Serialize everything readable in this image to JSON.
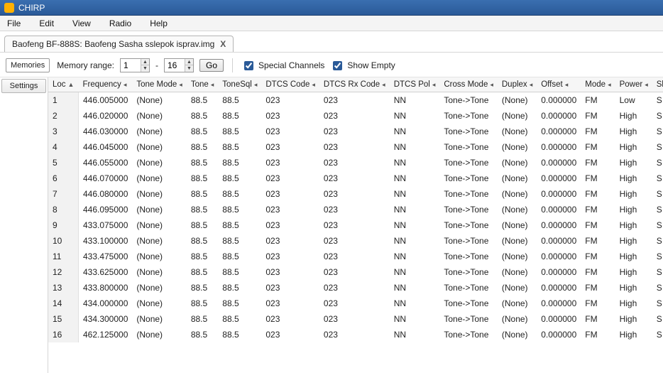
{
  "title": "CHIRP",
  "menu": [
    "File",
    "Edit",
    "View",
    "Radio",
    "Help"
  ],
  "tab": {
    "label": "Baofeng BF-888S: Baofeng Sasha sslepok isprav.img",
    "close": "X"
  },
  "side": {
    "memories": "Memories",
    "settings": "Settings"
  },
  "toolbar": {
    "range_label": "Memory range:",
    "range_from": "1",
    "range_sep": "-",
    "range_to": "16",
    "go": "Go",
    "special": "Special Channels",
    "show_empty": "Show Empty"
  },
  "columns": [
    "Loc",
    "Frequency",
    "Tone Mode",
    "Tone",
    "ToneSql",
    "DTCS Code",
    "DTCS Rx Code",
    "DTCS Pol",
    "Cross Mode",
    "Duplex",
    "Offset",
    "Mode",
    "Power",
    "Skip"
  ],
  "rows": [
    {
      "loc": "1",
      "freq": "446.005000",
      "tm": "(None)",
      "tone": "88.5",
      "tsql": "88.5",
      "dtcs": "023",
      "dtcsrx": "023",
      "pol": "NN",
      "cross": "Tone->Tone",
      "dup": "(None)",
      "off": "0.000000",
      "mode": "FM",
      "pow": "Low",
      "skip": "S"
    },
    {
      "loc": "2",
      "freq": "446.020000",
      "tm": "(None)",
      "tone": "88.5",
      "tsql": "88.5",
      "dtcs": "023",
      "dtcsrx": "023",
      "pol": "NN",
      "cross": "Tone->Tone",
      "dup": "(None)",
      "off": "0.000000",
      "mode": "FM",
      "pow": "High",
      "skip": "S"
    },
    {
      "loc": "3",
      "freq": "446.030000",
      "tm": "(None)",
      "tone": "88.5",
      "tsql": "88.5",
      "dtcs": "023",
      "dtcsrx": "023",
      "pol": "NN",
      "cross": "Tone->Tone",
      "dup": "(None)",
      "off": "0.000000",
      "mode": "FM",
      "pow": "High",
      "skip": "S"
    },
    {
      "loc": "4",
      "freq": "446.045000",
      "tm": "(None)",
      "tone": "88.5",
      "tsql": "88.5",
      "dtcs": "023",
      "dtcsrx": "023",
      "pol": "NN",
      "cross": "Tone->Tone",
      "dup": "(None)",
      "off": "0.000000",
      "mode": "FM",
      "pow": "High",
      "skip": "S"
    },
    {
      "loc": "5",
      "freq": "446.055000",
      "tm": "(None)",
      "tone": "88.5",
      "tsql": "88.5",
      "dtcs": "023",
      "dtcsrx": "023",
      "pol": "NN",
      "cross": "Tone->Tone",
      "dup": "(None)",
      "off": "0.000000",
      "mode": "FM",
      "pow": "High",
      "skip": "S"
    },
    {
      "loc": "6",
      "freq": "446.070000",
      "tm": "(None)",
      "tone": "88.5",
      "tsql": "88.5",
      "dtcs": "023",
      "dtcsrx": "023",
      "pol": "NN",
      "cross": "Tone->Tone",
      "dup": "(None)",
      "off": "0.000000",
      "mode": "FM",
      "pow": "High",
      "skip": "S"
    },
    {
      "loc": "7",
      "freq": "446.080000",
      "tm": "(None)",
      "tone": "88.5",
      "tsql": "88.5",
      "dtcs": "023",
      "dtcsrx": "023",
      "pol": "NN",
      "cross": "Tone->Tone",
      "dup": "(None)",
      "off": "0.000000",
      "mode": "FM",
      "pow": "High",
      "skip": "S"
    },
    {
      "loc": "8",
      "freq": "446.095000",
      "tm": "(None)",
      "tone": "88.5",
      "tsql": "88.5",
      "dtcs": "023",
      "dtcsrx": "023",
      "pol": "NN",
      "cross": "Tone->Tone",
      "dup": "(None)",
      "off": "0.000000",
      "mode": "FM",
      "pow": "High",
      "skip": "S"
    },
    {
      "loc": "9",
      "freq": "433.075000",
      "tm": "(None)",
      "tone": "88.5",
      "tsql": "88.5",
      "dtcs": "023",
      "dtcsrx": "023",
      "pol": "NN",
      "cross": "Tone->Tone",
      "dup": "(None)",
      "off": "0.000000",
      "mode": "FM",
      "pow": "High",
      "skip": "S"
    },
    {
      "loc": "10",
      "freq": "433.100000",
      "tm": "(None)",
      "tone": "88.5",
      "tsql": "88.5",
      "dtcs": "023",
      "dtcsrx": "023",
      "pol": "NN",
      "cross": "Tone->Tone",
      "dup": "(None)",
      "off": "0.000000",
      "mode": "FM",
      "pow": "High",
      "skip": "S"
    },
    {
      "loc": "11",
      "freq": "433.475000",
      "tm": "(None)",
      "tone": "88.5",
      "tsql": "88.5",
      "dtcs": "023",
      "dtcsrx": "023",
      "pol": "NN",
      "cross": "Tone->Tone",
      "dup": "(None)",
      "off": "0.000000",
      "mode": "FM",
      "pow": "High",
      "skip": "S"
    },
    {
      "loc": "12",
      "freq": "433.625000",
      "tm": "(None)",
      "tone": "88.5",
      "tsql": "88.5",
      "dtcs": "023",
      "dtcsrx": "023",
      "pol": "NN",
      "cross": "Tone->Tone",
      "dup": "(None)",
      "off": "0.000000",
      "mode": "FM",
      "pow": "High",
      "skip": "S"
    },
    {
      "loc": "13",
      "freq": "433.800000",
      "tm": "(None)",
      "tone": "88.5",
      "tsql": "88.5",
      "dtcs": "023",
      "dtcsrx": "023",
      "pol": "NN",
      "cross": "Tone->Tone",
      "dup": "(None)",
      "off": "0.000000",
      "mode": "FM",
      "pow": "High",
      "skip": "S"
    },
    {
      "loc": "14",
      "freq": "434.000000",
      "tm": "(None)",
      "tone": "88.5",
      "tsql": "88.5",
      "dtcs": "023",
      "dtcsrx": "023",
      "pol": "NN",
      "cross": "Tone->Tone",
      "dup": "(None)",
      "off": "0.000000",
      "mode": "FM",
      "pow": "High",
      "skip": "S"
    },
    {
      "loc": "15",
      "freq": "434.300000",
      "tm": "(None)",
      "tone": "88.5",
      "tsql": "88.5",
      "dtcs": "023",
      "dtcsrx": "023",
      "pol": "NN",
      "cross": "Tone->Tone",
      "dup": "(None)",
      "off": "0.000000",
      "mode": "FM",
      "pow": "High",
      "skip": "S"
    },
    {
      "loc": "16",
      "freq": "462.125000",
      "tm": "(None)",
      "tone": "88.5",
      "tsql": "88.5",
      "dtcs": "023",
      "dtcsrx": "023",
      "pol": "NN",
      "cross": "Tone->Tone",
      "dup": "(None)",
      "off": "0.000000",
      "mode": "FM",
      "pow": "High",
      "skip": "S"
    }
  ]
}
